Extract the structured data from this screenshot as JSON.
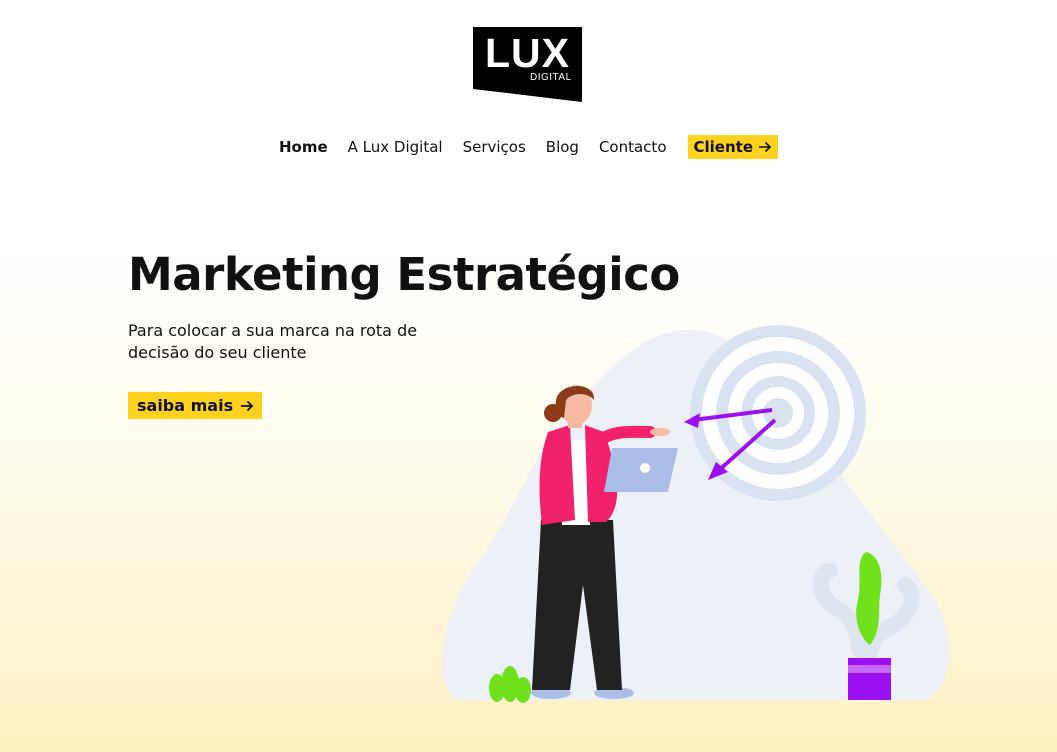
{
  "logo": {
    "main": "LUX",
    "sub": "DIGITAL"
  },
  "nav": {
    "items": [
      {
        "label": "Home",
        "active": true
      },
      {
        "label": "A Lux Digital",
        "active": false
      },
      {
        "label": "Serviços",
        "active": false
      },
      {
        "label": "Blog",
        "active": false
      },
      {
        "label": "Contacto",
        "active": false
      }
    ],
    "cliente_label": "Cliente",
    "cliente_icon": "arrow-right-icon"
  },
  "hero": {
    "title": "Marketing Estratégico",
    "subtitle": "Para colocar a sua marca na rota de decisão do seu cliente",
    "cta_label": "saiba mais",
    "cta_icon": "arrow-right-icon"
  },
  "colors": {
    "accent": "#ffd21f",
    "text": "#111111",
    "purple": "#9b10f0",
    "green": "#6fe21b",
    "pink": "#f2216b"
  }
}
